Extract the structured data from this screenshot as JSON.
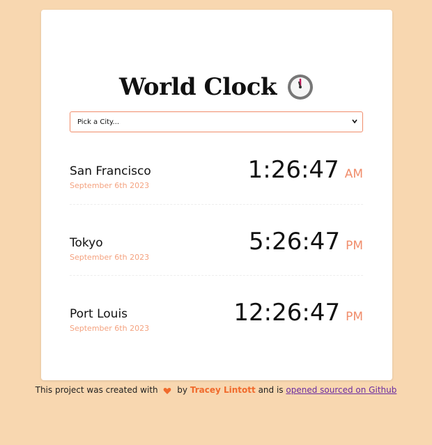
{
  "app": {
    "title": "World Clock",
    "clock_icon": "clock-icon"
  },
  "search": {
    "selected_value": "Pick a City..."
  },
  "cities": [
    {
      "name": "San Francisco",
      "date": "September 6th 2023",
      "time": "1:26:47",
      "ampm": "AM"
    },
    {
      "name": "Tokyo",
      "date": "September 6th 2023",
      "time": "5:26:47",
      "ampm": "PM"
    },
    {
      "name": "Port Louis",
      "date": "September 6th 2023",
      "time": "12:26:47",
      "ampm": "PM"
    }
  ],
  "footer": {
    "prefix": "This project was created with",
    "by": "by",
    "author": "Tracey Lintott",
    "middle": "and is",
    "github_link": "opened sourced on Github"
  },
  "colors": {
    "background": "#f8d7b0",
    "accent": "#f08c6a",
    "date": "#f4a27f",
    "author": "#f06a2c",
    "link": "#6a2ca0"
  }
}
